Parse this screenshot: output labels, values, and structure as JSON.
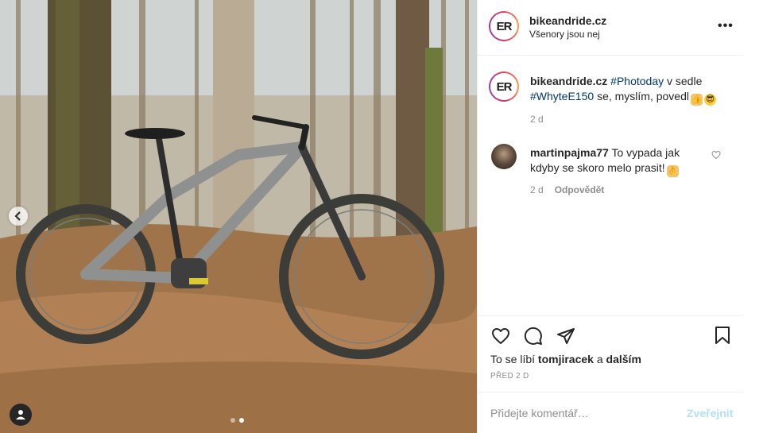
{
  "post": {
    "username": "bikeandride.cz",
    "location": "Všenory jsou nej",
    "avatar_text": "ER",
    "more_label": "•••",
    "caption": {
      "pre": "v sedle",
      "hashtag1": "#Photoday",
      "hashtag2": "#WhyteE150",
      "post": "se, myslím, povedl",
      "emoji1": "thumbs-up",
      "emoji2": "sunglasses-face"
    },
    "caption_time": "2 d"
  },
  "comments": [
    {
      "username": "martinpajma77",
      "text": "To vypada jak kdyby se skoro melo prasit!",
      "emoji": "ok-hand",
      "time": "2 d",
      "reply_label": "Odpovědět"
    }
  ],
  "actions": {
    "icons": [
      "heart-icon",
      "comment-icon",
      "share-icon",
      "bookmark-icon"
    ]
  },
  "likes": {
    "prefix": "To se líbí",
    "user": "tomjiracek",
    "joiner": "a",
    "others": "dalším"
  },
  "posted_ago": "PŘED 2 D",
  "add_comment": {
    "placeholder": "Přidejte komentář…",
    "publish_label": "Zveřejnit"
  },
  "carousel": {
    "slide_count": 2,
    "active_index": 1
  },
  "colors": {
    "hashtag": "#00376b",
    "muted": "#8e8e8e",
    "publish_disabled": "#b2dffc",
    "ring_start": "#e13f63",
    "ring_end": "#8e3fb5"
  }
}
